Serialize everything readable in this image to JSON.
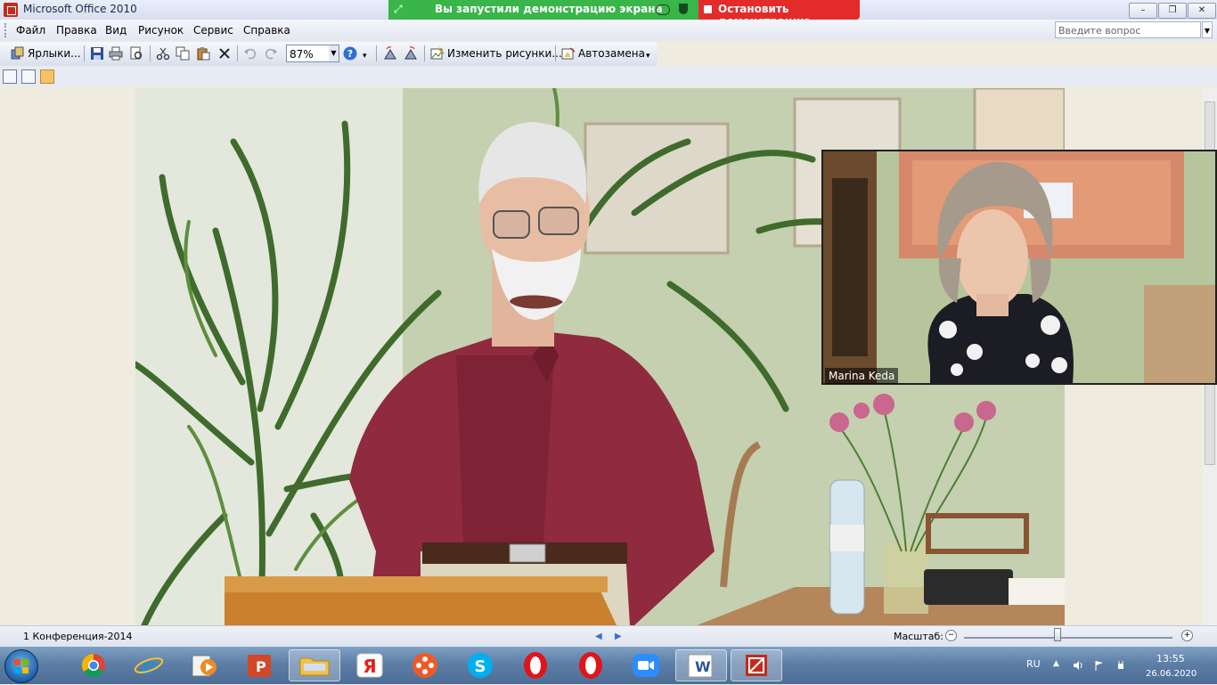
{
  "window": {
    "title": "Microsoft Office 2010"
  },
  "share_banner": {
    "text": "Вы запустили демонстрацию экрана",
    "stop_label": "Остановить демонстрацию"
  },
  "window_controls": {
    "minimize": "–",
    "restore": "❐",
    "close": "✕"
  },
  "menu": [
    "Файл",
    "Правка",
    "Вид",
    "Рисунок",
    "Сервис",
    "Справка"
  ],
  "help_search": {
    "placeholder": "Введите вопрос"
  },
  "toolbar": {
    "shortcuts_label": "Ярлыки...",
    "zoom_value": "87%",
    "change_pictures_label": "Изменить рисунки...",
    "autocorrect_label": "Автозамена"
  },
  "video_tile": {
    "participant_name": "Marina Keda"
  },
  "status": {
    "slide_label": "1 Конференция-2014",
    "zoom_label": "Масштаб:",
    "zoom_level_percent": 45
  },
  "taskbar": {
    "apps": [
      "chrome",
      "internet-explorer",
      "media-player",
      "powerpoint",
      "file-explorer",
      "yandex",
      "media-app",
      "skype",
      "opera",
      "opera",
      "zoom",
      "word",
      "picture-manager"
    ],
    "language": "RU",
    "time": "13:55",
    "date": "26.06.2020"
  },
  "colors": {
    "share_green": "#39b54a",
    "stop_red": "#e32b2b",
    "shirt": "#8f2a3f",
    "taskbar": "#5d7fa6"
  }
}
